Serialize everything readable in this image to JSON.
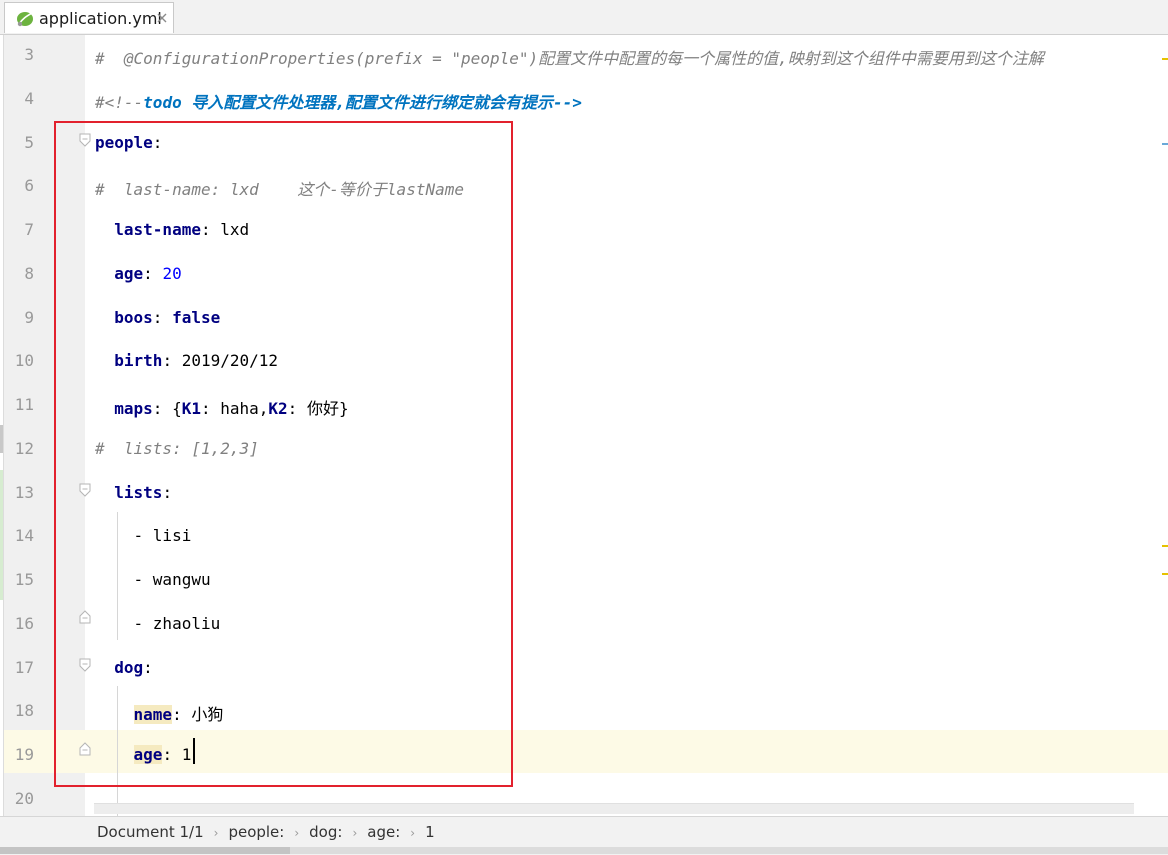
{
  "tab": {
    "label": "application.yml",
    "icon": "spring-leaf-icon"
  },
  "lines": [
    {
      "n": "3",
      "tokens": [
        {
          "t": "#  @ConfigurationProperties(prefix = \"people\")配置文件中配置的每一个属性的值,映射到这个组件中需要用到这个注解",
          "c": "cmt"
        }
      ]
    },
    {
      "n": "4",
      "tokens": [
        {
          "t": "#<!--",
          "c": "cmt"
        },
        {
          "t": "todo 导入配置文件处理器,配置文件进行绑定就会有提示-->",
          "c": "todo"
        }
      ]
    },
    {
      "n": "5",
      "tokens": [
        {
          "t": "people",
          "c": "key"
        },
        {
          "t": ":",
          "c": ""
        }
      ]
    },
    {
      "n": "6",
      "tokens": [
        {
          "t": "#  last-name: lxd    这个-等价于lastName",
          "c": "cmt"
        }
      ]
    },
    {
      "n": "7",
      "tokens": [
        {
          "t": "  ",
          "c": ""
        },
        {
          "t": "last-name",
          "c": "key"
        },
        {
          "t": ": lxd",
          "c": ""
        }
      ]
    },
    {
      "n": "8",
      "tokens": [
        {
          "t": "  ",
          "c": ""
        },
        {
          "t": "age",
          "c": "key"
        },
        {
          "t": ": ",
          "c": ""
        },
        {
          "t": "20",
          "c": "num"
        }
      ]
    },
    {
      "n": "9",
      "tokens": [
        {
          "t": "  ",
          "c": ""
        },
        {
          "t": "boos",
          "c": "key"
        },
        {
          "t": ": ",
          "c": ""
        },
        {
          "t": "false",
          "c": "kw"
        }
      ]
    },
    {
      "n": "10",
      "tokens": [
        {
          "t": "  ",
          "c": ""
        },
        {
          "t": "birth",
          "c": "key"
        },
        {
          "t": ": 2019/20/12",
          "c": ""
        }
      ]
    },
    {
      "n": "11",
      "tokens": [
        {
          "t": "  ",
          "c": ""
        },
        {
          "t": "maps",
          "c": "key"
        },
        {
          "t": ": {",
          "c": ""
        },
        {
          "t": "K1",
          "c": "key"
        },
        {
          "t": ": haha,",
          "c": ""
        },
        {
          "t": "K2",
          "c": "key"
        },
        {
          "t": ": 你好}",
          "c": ""
        }
      ]
    },
    {
      "n": "12",
      "tokens": [
        {
          "t": "#  lists: [1,2,3]",
          "c": "cmt"
        }
      ]
    },
    {
      "n": "13",
      "tokens": [
        {
          "t": "  ",
          "c": ""
        },
        {
          "t": "lists",
          "c": "key"
        },
        {
          "t": ":",
          "c": ""
        }
      ]
    },
    {
      "n": "14",
      "tokens": [
        {
          "t": "    - lisi",
          "c": ""
        }
      ]
    },
    {
      "n": "15",
      "tokens": [
        {
          "t": "    - wangwu",
          "c": ""
        }
      ]
    },
    {
      "n": "16",
      "tokens": [
        {
          "t": "    - zhaoliu",
          "c": ""
        }
      ]
    },
    {
      "n": "17",
      "tokens": [
        {
          "t": "  ",
          "c": ""
        },
        {
          "t": "dog",
          "c": "key"
        },
        {
          "t": ":",
          "c": ""
        }
      ]
    },
    {
      "n": "18",
      "tokens": [
        {
          "t": "    ",
          "c": ""
        },
        {
          "t": "name",
          "c": "key hl"
        },
        {
          "t": ": 小狗",
          "c": ""
        }
      ]
    },
    {
      "n": "19",
      "tokens": [
        {
          "t": "    ",
          "c": ""
        },
        {
          "t": "age",
          "c": "key hl"
        },
        {
          "t": ": 1",
          "c": ""
        }
      ]
    },
    {
      "n": "20",
      "tokens": []
    }
  ],
  "current_line": "19",
  "breadcrumbs": [
    "Document 1/1",
    "people:",
    "dog:",
    "age:",
    "1"
  ],
  "colors": {
    "comment": "#808080",
    "todo": "#0073bf",
    "key": "#000080",
    "number": "#0000ff",
    "highlight_box": "#e2212d",
    "current_line_bg": "#fdfae6"
  }
}
